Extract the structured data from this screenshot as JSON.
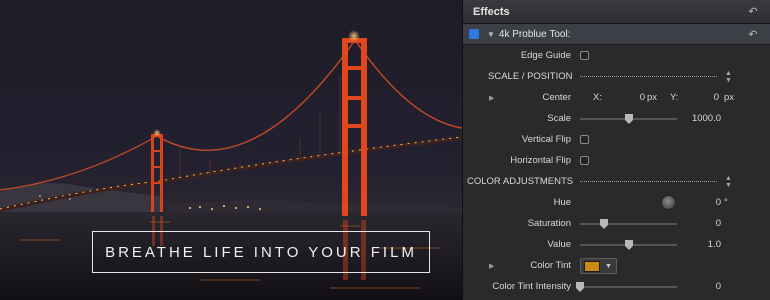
{
  "preview": {
    "overlay_title": "BREATHE LIFE INTO YOUR FILM"
  },
  "inspector": {
    "title": "Effects",
    "reset_icon": "reset-arrow-icon",
    "effect": {
      "name": "4k Problue Tool:",
      "enabled": true
    },
    "rows": {
      "edge_guide": {
        "label": "Edge Guide",
        "checked": false
      },
      "scale_position": {
        "label": "SCALE / POSITION"
      },
      "center": {
        "label": "Center",
        "x_label": "X:",
        "x_value": "0",
        "x_unit": "px",
        "y_label": "Y:",
        "y_value": "0",
        "y_unit": "px"
      },
      "scale": {
        "label": "Scale",
        "value": "1000.0",
        "slider_fraction": 0.5
      },
      "vertical_flip": {
        "label": "Vertical Flip",
        "checked": false
      },
      "horizontal_flip": {
        "label": "Horizontal Flip",
        "checked": false
      },
      "color_adjustments": {
        "label": "COLOR ADJUSTMENTS"
      },
      "hue": {
        "label": "Hue",
        "value": "0",
        "unit": "°"
      },
      "saturation": {
        "label": "Saturation",
        "value": "0",
        "slider_fraction": 0.25
      },
      "value": {
        "label": "Value",
        "value": "1.0",
        "slider_fraction": 0.5
      },
      "color_tint": {
        "label": "Color Tint",
        "color": "#c88c12"
      },
      "color_tint_intensity": {
        "label": "Color Tint Intensity",
        "value": "0",
        "slider_fraction": 0.0
      }
    }
  },
  "colors": {
    "accent_blue": "#2f78e4",
    "bridge_red": "#d8431e"
  }
}
